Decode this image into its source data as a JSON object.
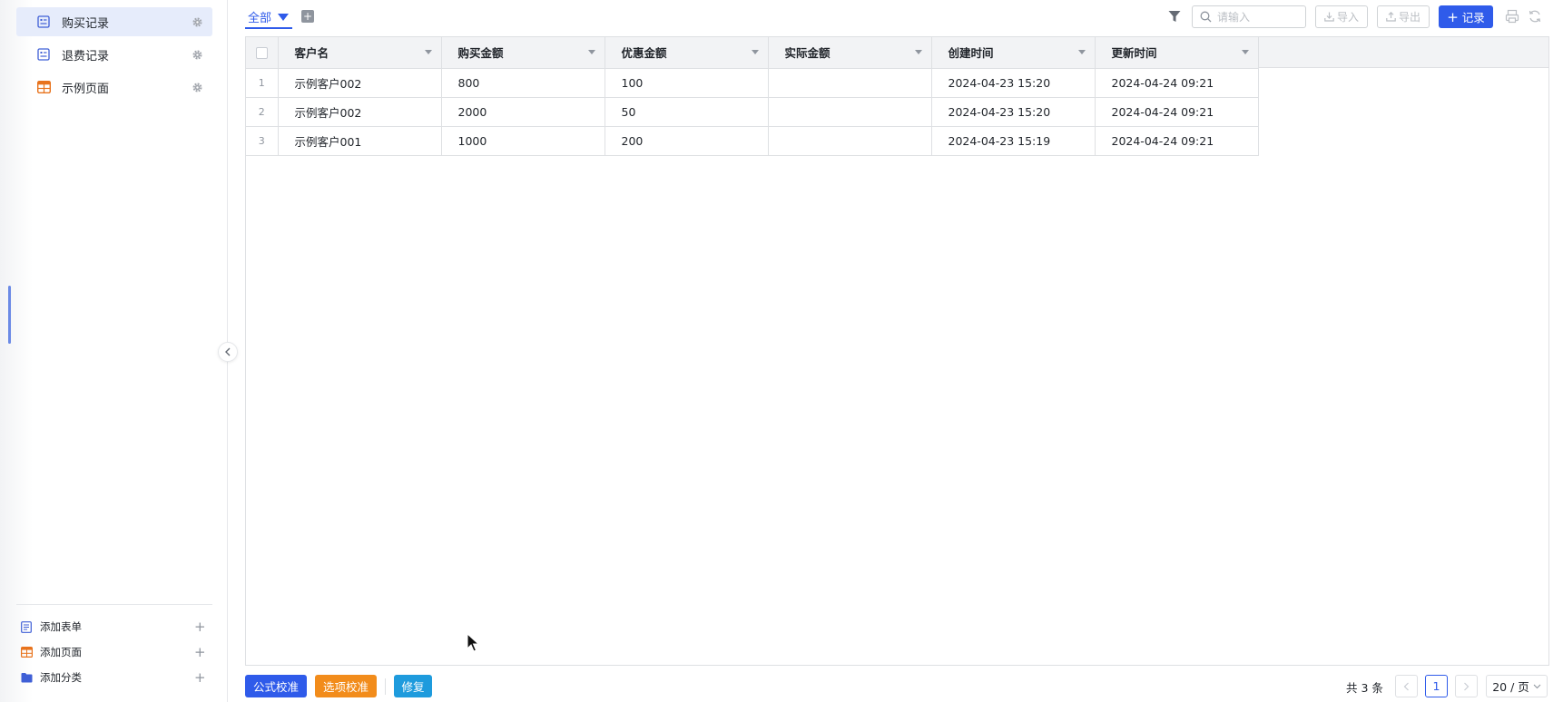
{
  "sidebar": {
    "items": [
      {
        "label": "购买记录",
        "icon": "form-icon",
        "active": true
      },
      {
        "label": "退费记录",
        "icon": "form-icon",
        "active": false
      },
      {
        "label": "示例页面",
        "icon": "page-table-icon",
        "active": false
      }
    ],
    "add_items": [
      {
        "label": "添加表单",
        "icon": "form-icon"
      },
      {
        "label": "添加页面",
        "icon": "page-table-icon"
      },
      {
        "label": "添加分类",
        "icon": "folder-icon"
      }
    ]
  },
  "toolbar": {
    "view_tab": "全部",
    "search_placeholder": "请输入",
    "import_label": "导入",
    "export_label": "导出",
    "add_record_label": "记录"
  },
  "table": {
    "columns": [
      "客户名",
      "购买金额",
      "优惠金额",
      "实际金额",
      "创建时间",
      "更新时间"
    ],
    "rows": [
      {
        "index": "1",
        "cells": [
          "示例客户002",
          "800",
          "100",
          "",
          "2024-04-23 15:20",
          "2024-04-24 09:21"
        ]
      },
      {
        "index": "2",
        "cells": [
          "示例客户002",
          "2000",
          "50",
          "",
          "2024-04-23 15:20",
          "2024-04-24 09:21"
        ]
      },
      {
        "index": "3",
        "cells": [
          "示例客户001",
          "1000",
          "200",
          "",
          "2024-04-23 15:19",
          "2024-04-24 09:21"
        ]
      }
    ]
  },
  "footer": {
    "formula_btn": "公式校准",
    "option_btn": "选项校准",
    "repair_btn": "修复",
    "total_text": "共 3 条",
    "current_page": "1",
    "page_size": "20 / 页"
  },
  "colors": {
    "primary": "#2f5bea",
    "orange": "#f28c1b",
    "cyan": "#1e9bdd"
  }
}
